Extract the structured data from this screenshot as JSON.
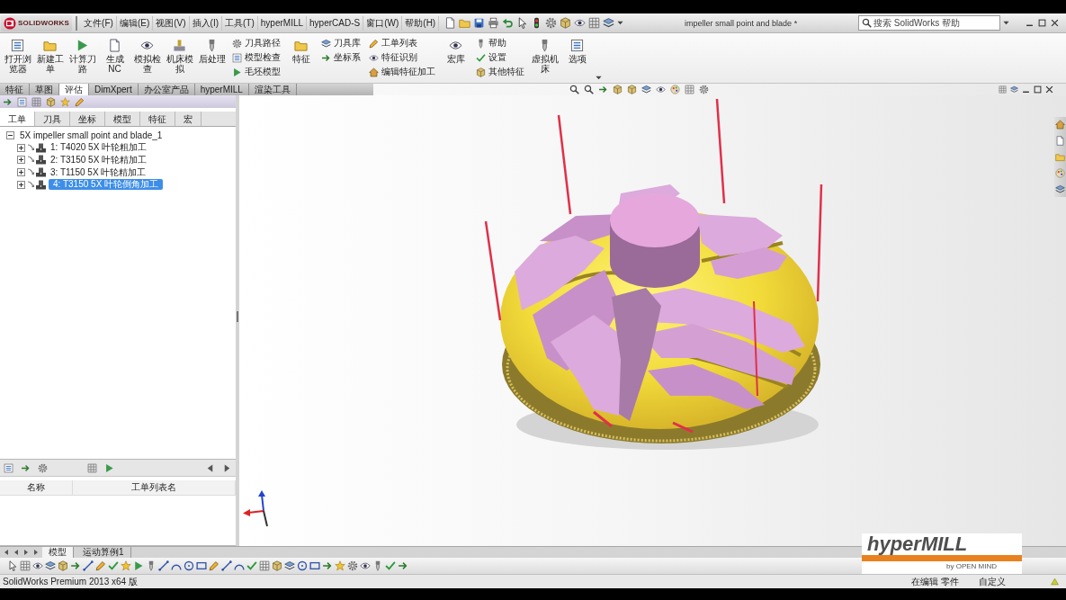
{
  "title_bar": {
    "logo_text": "SOLIDWORKS",
    "menu": [
      "文件(F)",
      "编辑(E)",
      "视图(V)",
      "插入(I)",
      "工具(T)",
      "hyperMILL",
      "hyperCAD-S",
      "窗口(W)",
      "帮助(H)"
    ],
    "document_title": "impeller small point and blade *",
    "search": {
      "placeholder": "搜索 SolidWorks 帮助"
    }
  },
  "ribbon": {
    "items": [
      {
        "kind": "large",
        "label": "打开浏览器"
      },
      {
        "kind": "large",
        "label": "新建工单"
      },
      {
        "kind": "large",
        "label": "计算刀路"
      },
      {
        "kind": "large",
        "label": "生成NC"
      },
      {
        "kind": "large",
        "label": "模拟检查"
      },
      {
        "kind": "large",
        "label": "机床模拟"
      },
      {
        "kind": "large",
        "label": "后处理"
      },
      {
        "kind": "column",
        "items": [
          "刀具路径",
          "模型检查",
          "毛坯模型"
        ]
      },
      {
        "kind": "large",
        "label": "特征"
      },
      {
        "kind": "column",
        "items": [
          "刀具库",
          "坐标系"
        ]
      },
      {
        "kind": "column",
        "items": [
          "工单列表",
          "特征识别",
          "编辑特征加工"
        ]
      },
      {
        "kind": "large",
        "label": "宏库"
      },
      {
        "kind": "column",
        "items": [
          "帮助",
          "设置",
          "其他特征"
        ]
      },
      {
        "kind": "large",
        "label": "虚拟机床"
      },
      {
        "kind": "large",
        "label": "选项"
      }
    ]
  },
  "command_tabs": [
    {
      "label": "特征",
      "selected": false
    },
    {
      "label": "草图",
      "selected": false
    },
    {
      "label": "评估",
      "selected": true
    },
    {
      "label": "DimXpert",
      "selected": false
    },
    {
      "label": "办公室产品",
      "selected": false
    },
    {
      "label": "hyperMILL",
      "selected": false
    },
    {
      "label": "渲染工具",
      "selected": false
    }
  ],
  "panel_tabs": [
    {
      "label": "工单",
      "selected": true
    },
    {
      "label": "刀具",
      "selected": false
    },
    {
      "label": "坐标",
      "selected": false
    },
    {
      "label": "模型",
      "selected": false
    },
    {
      "label": "特征",
      "selected": false
    },
    {
      "label": "宏",
      "selected": false
    }
  ],
  "job_tree": {
    "label": "5X impeller small point and blade_1",
    "expanded": true,
    "children": [
      {
        "label": "1: T4020 5X 叶轮粗加工",
        "expanded": false,
        "selected": false
      },
      {
        "label": "2: T3150 5X 叶轮精加工",
        "expanded": false,
        "selected": false
      },
      {
        "label": "3: T1150 5X 叶轮精加工",
        "expanded": false,
        "selected": false
      },
      {
        "label": "4: T3150 5X 叶轮倒角加工",
        "expanded": false,
        "selected": true
      }
    ]
  },
  "list_panel": {
    "columns": [
      "名称",
      "工单列表名"
    ]
  },
  "bottom_tabs": [
    {
      "label": "模型",
      "selected": true
    },
    {
      "label": "运动算例1",
      "selected": false
    }
  ],
  "status_bar": {
    "left": "SolidWorks Premium 2013 x64 版",
    "right": [
      "在编辑 零件",
      "自定义"
    ]
  },
  "overlay_logo": {
    "name": "hyperMILL",
    "tagline": "by OPEN MIND"
  }
}
